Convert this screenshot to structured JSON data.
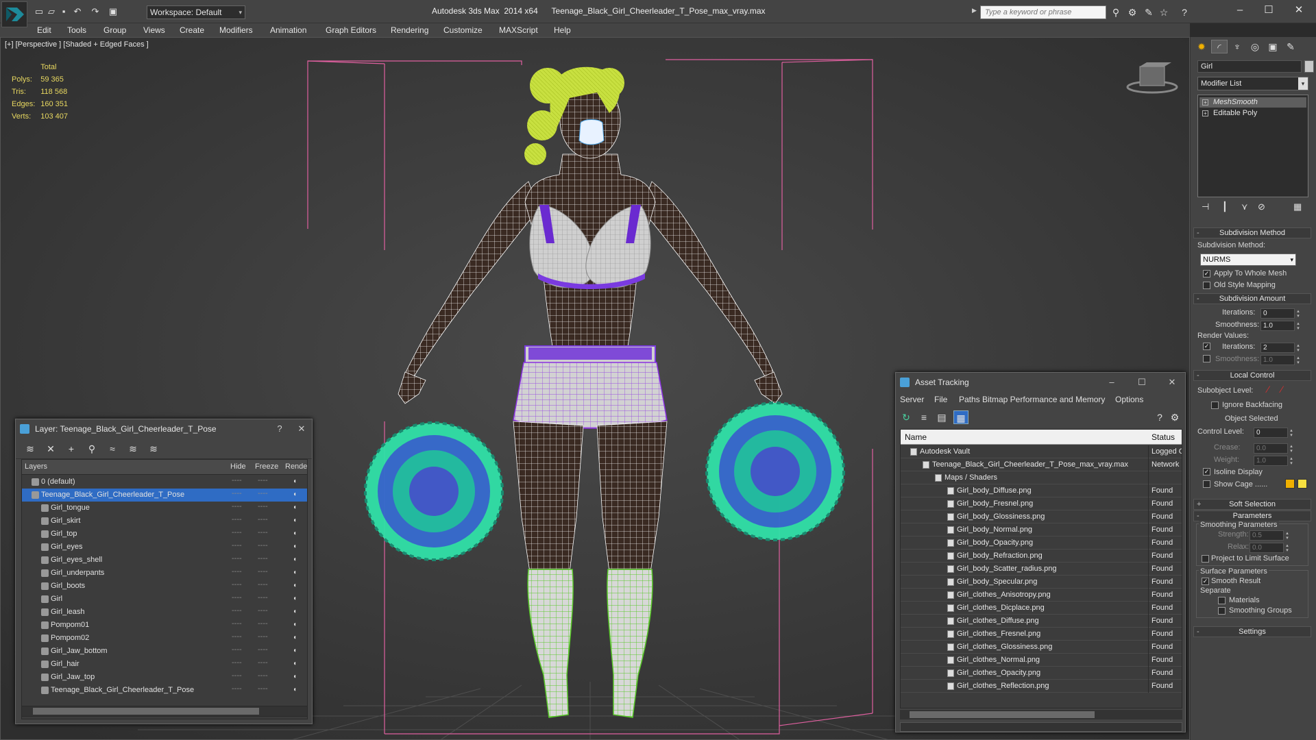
{
  "app": {
    "window_title": "Autodesk 3ds Max  2014 x64      Teenage_Black_Girl_Cheerleader_T_Pose_max_vray.max",
    "workspace_label": "Workspace: Default",
    "search_placeholder": "Type a keyword or phrase"
  },
  "menu": [
    "Edit",
    "Tools",
    "Group",
    "Views",
    "Create",
    "Modifiers",
    "Animation",
    "Graph Editors",
    "Rendering",
    "Customize",
    "MAXScript",
    "Help"
  ],
  "viewport": {
    "label": "[+] [Perspective ] [Shaded + Edged Faces ]",
    "stats": {
      "header": "Total",
      "rows": [
        {
          "label": "Polys:",
          "value": "59 365"
        },
        {
          "label": "Tris:",
          "value": "118 568"
        },
        {
          "label": "Edges:",
          "value": "160 351"
        },
        {
          "label": "Verts:",
          "value": "103 407"
        }
      ]
    },
    "viewcube_label": "FRONT"
  },
  "layer_panel": {
    "title": "Layer: Teenage_Black_Girl_Cheerleader_T_Pose",
    "help": "?",
    "close": "✕",
    "columns": {
      "name": "Layers",
      "hide": "Hide",
      "freeze": "Freeze",
      "render": "Render"
    },
    "rows": [
      {
        "name": "0 (default)",
        "level": 0
      },
      {
        "name": "Teenage_Black_Girl_Cheerleader_T_Pose",
        "level": 0,
        "selected": true
      },
      {
        "name": "Girl_tongue",
        "level": 1
      },
      {
        "name": "Girl_skirt",
        "level": 1
      },
      {
        "name": "Girl_top",
        "level": 1
      },
      {
        "name": "Girl_eyes",
        "level": 1
      },
      {
        "name": "Girl_eyes_shell",
        "level": 1
      },
      {
        "name": "Girl_underpants",
        "level": 1
      },
      {
        "name": "Girl_boots",
        "level": 1
      },
      {
        "name": "Girl",
        "level": 1
      },
      {
        "name": "Girl_leash",
        "level": 1
      },
      {
        "name": "Pompom01",
        "level": 1
      },
      {
        "name": "Pompom02",
        "level": 1
      },
      {
        "name": "Girl_Jaw_bottom",
        "level": 1
      },
      {
        "name": "Girl_hair",
        "level": 1
      },
      {
        "name": "Girl_Jaw_top",
        "level": 1
      },
      {
        "name": "Teenage_Black_Girl_Cheerleader_T_Pose",
        "level": 1
      }
    ]
  },
  "asset_panel": {
    "title": "Asset Tracking",
    "menu": [
      "Server",
      "File",
      "Paths",
      "Bitmap Performance and Memory",
      "Options"
    ],
    "columns": {
      "name": "Name",
      "status": "Status"
    },
    "rows": [
      {
        "name": "Autodesk Vault",
        "status": "Logged O",
        "level": 0
      },
      {
        "name": "Teenage_Black_Girl_Cheerleader_T_Pose_max_vray.max",
        "status": "Network",
        "level": 1
      },
      {
        "name": "Maps / Shaders",
        "status": "",
        "level": 2
      },
      {
        "name": "Girl_body_Diffuse.png",
        "status": "Found",
        "level": 3
      },
      {
        "name": "Girl_body_Fresnel.png",
        "status": "Found",
        "level": 3
      },
      {
        "name": "Girl_body_Glossiness.png",
        "status": "Found",
        "level": 3
      },
      {
        "name": "Girl_body_Normal.png",
        "status": "Found",
        "level": 3
      },
      {
        "name": "Girl_body_Opacity.png",
        "status": "Found",
        "level": 3
      },
      {
        "name": "Girl_body_Refraction.png",
        "status": "Found",
        "level": 3
      },
      {
        "name": "Girl_body_Scatter_radius.png",
        "status": "Found",
        "level": 3
      },
      {
        "name": "Girl_body_Specular.png",
        "status": "Found",
        "level": 3
      },
      {
        "name": "Girl_clothes_Anisotropy.png",
        "status": "Found",
        "level": 3
      },
      {
        "name": "Girl_clothes_Dicplace.png",
        "status": "Found",
        "level": 3
      },
      {
        "name": "Girl_clothes_Diffuse.png",
        "status": "Found",
        "level": 3
      },
      {
        "name": "Girl_clothes_Fresnel.png",
        "status": "Found",
        "level": 3
      },
      {
        "name": "Girl_clothes_Glossiness.png",
        "status": "Found",
        "level": 3
      },
      {
        "name": "Girl_clothes_Normal.png",
        "status": "Found",
        "level": 3
      },
      {
        "name": "Girl_clothes_Opacity.png",
        "status": "Found",
        "level": 3
      },
      {
        "name": "Girl_clothes_Reflection.png",
        "status": "Found",
        "level": 3
      }
    ]
  },
  "command_panel": {
    "object_name": "Girl",
    "modifier_list": "Modifier List",
    "stack": [
      "MeshSmooth",
      "Editable Poly"
    ],
    "subdivision_method": {
      "rollout": "Subdivision Method",
      "label": "Subdivision Method:",
      "value": "NURMS",
      "apply_whole_mesh": "Apply To Whole Mesh",
      "old_style_mapping": "Old Style Mapping"
    },
    "subdivision_amount": {
      "rollout": "Subdivision Amount",
      "iterations_label": "Iterations:",
      "iterations": "0",
      "smoothness_label": "Smoothness:",
      "smoothness": "1.0",
      "render_values": "Render Values:",
      "r_iterations": "2",
      "r_smoothness": "1.0"
    },
    "local_control": {
      "rollout": "Local Control",
      "subobject_level": "Subobject Level:",
      "ignore_backfacing": "Ignore Backfacing",
      "object_selected": "Object Selected",
      "control_level_label": "Control Level:",
      "control_level": "0",
      "crease_label": "Crease:",
      "crease": "0.0",
      "weight_label": "Weight:",
      "weight": "1.0",
      "isoline_display": "Isoline Display",
      "show_cage": "Show Cage ......"
    },
    "soft_selection": "Soft Selection",
    "parameters": {
      "rollout": "Parameters",
      "smoothing_params": "Smoothing Parameters",
      "strength_label": "Strength:",
      "strength": "0.5",
      "relax_label": "Relax:",
      "relax": "0.0",
      "project_limit": "Project to Limit Surface",
      "surface_params": "Surface Parameters",
      "smooth_result": "Smooth Result",
      "separate": "Separate",
      "materials": "Materials",
      "smoothing_groups": "Smoothing Groups"
    },
    "settings": "Settings"
  },
  "colors": {
    "wireframe_body": "#ffffff",
    "skirt_wire": "#8a30e0",
    "pompom_green": "#20d8a0",
    "pompom_blue": "#4040d0",
    "boots_wire": "#58c828",
    "hair": "#c8e040",
    "bbox_lines": "#e060a0",
    "selection_blue": "#2f6cc4",
    "stats_yellow": "#e8d860",
    "cage_swatch_1": "#f0b000",
    "cage_swatch_2": "#f8e040"
  }
}
